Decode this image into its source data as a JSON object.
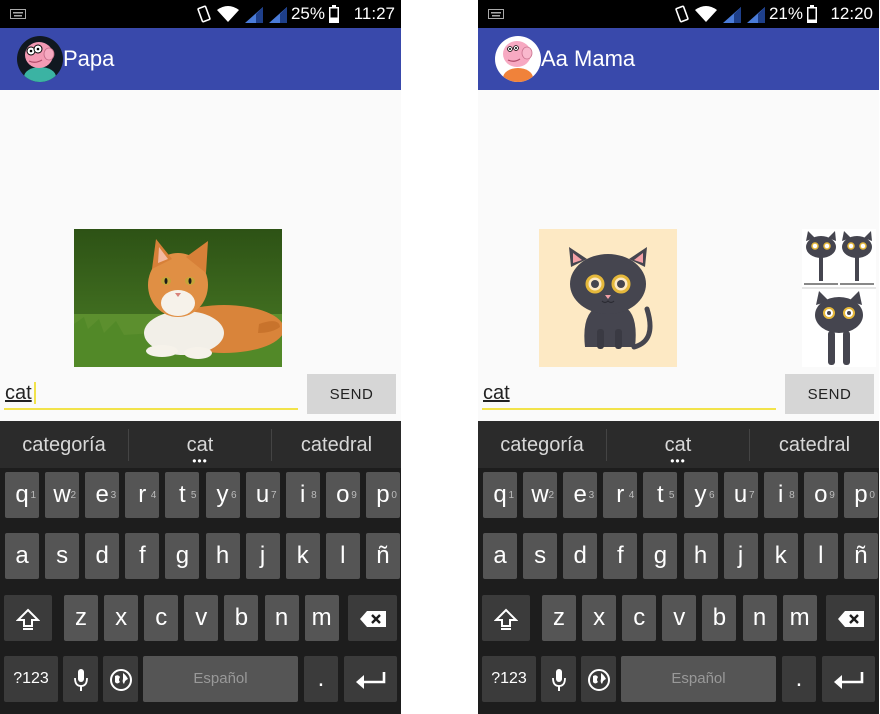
{
  "phones": [
    {
      "status": {
        "battery": "25%",
        "time": "11:27"
      },
      "app_title": "Papa",
      "avatar": "papa-pig",
      "message_input": {
        "value": "cat"
      },
      "send_label": "SEND",
      "suggestions": [
        "categoría",
        "cat",
        "catedral"
      ],
      "images": [
        "photo of orange cat lying on grass"
      ]
    },
    {
      "status": {
        "battery": "21%",
        "time": "12:20"
      },
      "app_title": "Aa Mama",
      "avatar": "mama-pig",
      "message_input": {
        "value": "cat"
      },
      "send_label": "SEND",
      "suggestions": [
        "categoría",
        "cat",
        "catedral"
      ],
      "images": [
        "cartoon black cat on beige",
        "cartoon black cats sticker strip"
      ]
    }
  ],
  "keyboard": {
    "row1": [
      [
        "q",
        "1"
      ],
      [
        "w",
        "2"
      ],
      [
        "e",
        "3"
      ],
      [
        "r",
        "4"
      ],
      [
        "t",
        "5"
      ],
      [
        "y",
        "6"
      ],
      [
        "u",
        "7"
      ],
      [
        "i",
        "8"
      ],
      [
        "o",
        "9"
      ],
      [
        "p",
        "0"
      ]
    ],
    "row2": [
      "a",
      "s",
      "d",
      "f",
      "g",
      "h",
      "j",
      "k",
      "l",
      "ñ"
    ],
    "row3": [
      "z",
      "x",
      "c",
      "v",
      "b",
      "n",
      "m"
    ],
    "symbols_label": "?123",
    "space_label": "Español",
    "period_label": "."
  },
  "colors": {
    "appbar": "#3949ab",
    "accent": "#f2e34a"
  }
}
